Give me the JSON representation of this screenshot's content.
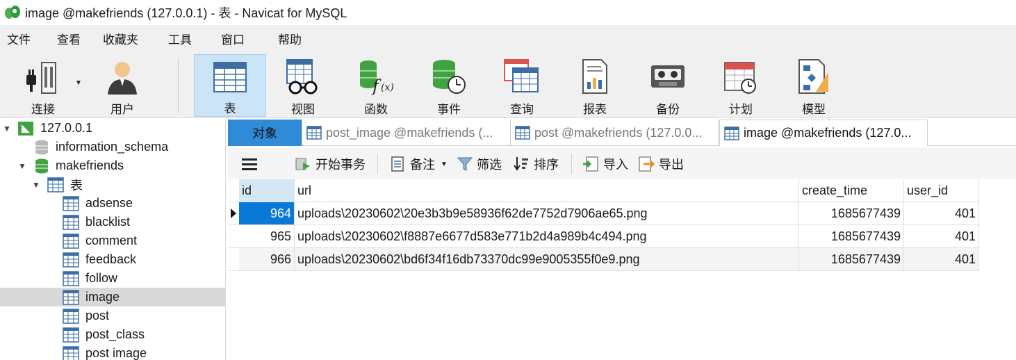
{
  "window": {
    "title": "image @makefriends (127.0.0.1) - 表 - Navicat for MySQL"
  },
  "menu": [
    "文件",
    "查看",
    "收藏夹",
    "工具",
    "窗口",
    "帮助"
  ],
  "toolbar": {
    "connect": "连接",
    "user": "用户",
    "table": "表",
    "view": "视图",
    "function": "函数",
    "event": "事件",
    "query": "查询",
    "report": "报表",
    "backup": "备份",
    "schedule": "计划",
    "model": "模型"
  },
  "tree": {
    "connection": "127.0.0.1",
    "db_info": "information_schema",
    "db_main": "makefriends",
    "tables_folder": "表",
    "tables": [
      "adsense",
      "blacklist",
      "comment",
      "feedback",
      "follow",
      "image",
      "post",
      "post_class",
      "post image"
    ],
    "selected_table": "image"
  },
  "tabs": {
    "objects": "对象",
    "t1": "post_image @makefriends (...",
    "t2": "post @makefriends (127.0.0...",
    "t3": "image @makefriends (127.0..."
  },
  "gridtools": {
    "begin_tx": "开始事务",
    "memo": "备注",
    "filter": "筛选",
    "sort": "排序",
    "import": "导入",
    "export": "导出"
  },
  "grid": {
    "columns": [
      "id",
      "url",
      "create_time",
      "user_id"
    ],
    "rows": [
      {
        "id": "964",
        "url": "uploads\\20230602\\20e3b3b9e58936f62de7752d7906ae65.png",
        "create_time": "1685677439",
        "user_id": "401"
      },
      {
        "id": "965",
        "url": "uploads\\20230602\\f8887e6677d583e771b2d4a989b4c494.png",
        "create_time": "1685677439",
        "user_id": "401"
      },
      {
        "id": "966",
        "url": "uploads\\20230602\\bd6f34f16db73370dc99e9005355f0e9.png",
        "create_time": "1685677439",
        "user_id": "401"
      }
    ]
  },
  "colors": {
    "accent": "#2f8ad8",
    "selected_cell": "#0a78d7",
    "tool_active": "#cce4f7"
  }
}
